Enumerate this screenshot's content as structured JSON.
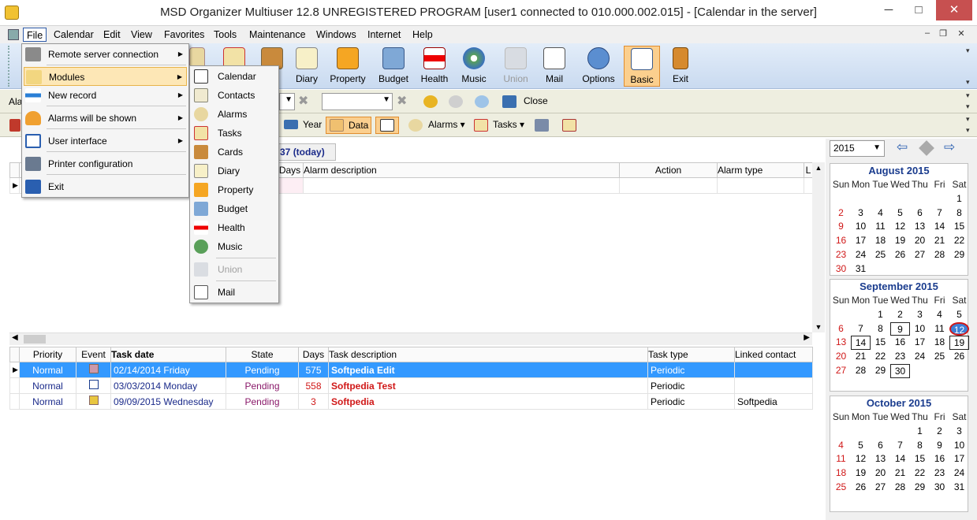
{
  "title": "MSD Organizer Multiuser 12.8 UNREGISTERED PROGRAM [user1 connected to 010.000.002.015] - [Calendar in the server]",
  "window_controls": {
    "minimize": "─",
    "maximize": "□",
    "close": "✕"
  },
  "menu": [
    "File",
    "Calendar",
    "Edit",
    "View",
    "Favorites",
    "Tools",
    "Maintenance",
    "Windows",
    "Internet",
    "Help"
  ],
  "mdi_controls": {
    "minimize": "‒",
    "restore": "❐",
    "close": "✕"
  },
  "toolbar": {
    "diary": "Diary",
    "property": "Property",
    "budget": "Budget",
    "health": "Health",
    "music": "Music",
    "union": "Union",
    "mail": "Mail",
    "options": "Options",
    "basic": "Basic",
    "exit": "Exit",
    "partial": "s"
  },
  "toolbar2": {
    "close": "Close",
    "left_label": "Ala"
  },
  "toolbar3": {
    "year": "Year",
    "data": "Data",
    "alarms": "Alarms",
    "tasks": "Tasks"
  },
  "week_tab": "k 37 (today)",
  "alarm_grid": {
    "headers": [
      "Days",
      "Alarm description",
      "Action",
      "Alarm type",
      "L"
    ]
  },
  "task_grid": {
    "headers": [
      "Priority",
      "Event",
      "Task date",
      "State",
      "Days",
      "Task description",
      "Task type",
      "Linked contact"
    ],
    "rows": [
      {
        "priority": "Normal",
        "date": "02/14/2014 Friday",
        "state": "Pending",
        "days": "575",
        "desc": "Softpedia Edit",
        "type": "Periodic",
        "contact": ""
      },
      {
        "priority": "Normal",
        "date": "03/03/2014 Monday",
        "state": "Pending",
        "days": "558",
        "desc": "Softpedia Test",
        "type": "Periodic",
        "contact": ""
      },
      {
        "priority": "Normal",
        "date": "09/09/2015 Wednesday",
        "state": "Pending",
        "days": "3",
        "desc": "Softpedia",
        "type": "Periodic",
        "contact": "Softpedia"
      }
    ]
  },
  "year_select": "2015",
  "dow": [
    "Sun",
    "Mon",
    "Tue",
    "Wed",
    "Thu",
    "Fri",
    "Sat"
  ],
  "months": [
    {
      "name": "August 2015",
      "start": 6,
      "days": 31,
      "boxed": [],
      "today": null
    },
    {
      "name": "September 2015",
      "start": 2,
      "days": 30,
      "boxed": [
        9,
        14,
        19,
        30
      ],
      "today": 12
    },
    {
      "name": "October 2015",
      "start": 4,
      "days": 31,
      "boxed": [],
      "today": null
    }
  ],
  "file_menu": [
    "Remote server connection",
    "Modules",
    "New record",
    "Alarms will be shown",
    "User interface",
    "Printer configuration",
    "Exit"
  ],
  "modules_menu": [
    "Calendar",
    "Contacts",
    "Alarms",
    "Tasks",
    "Cards",
    "Diary",
    "Property",
    "Budget",
    "Health",
    "Music",
    "Union",
    "Mail"
  ],
  "colors": {
    "accent": "#3399ff",
    "red_text": "#d01818",
    "today_blue": "#3e7fd6",
    "highlight": "#fbcf8e"
  }
}
